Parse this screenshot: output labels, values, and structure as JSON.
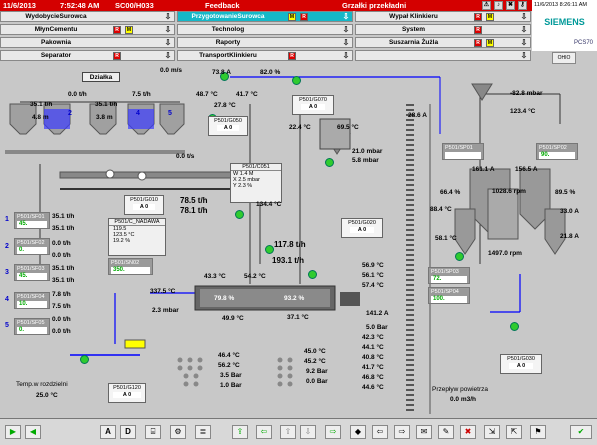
{
  "topbar": {
    "date": "11/6/2013",
    "time": "7:52:48 AM",
    "server": "SC00/H033",
    "center": "Feedback",
    "alarm": "Grzałki przekładni",
    "datetime_right": "11/6/2013 8:26:11 AM"
  },
  "nav": {
    "left": [
      "WydobycieSurowca",
      "MłynCementu",
      "Pakownia",
      "Separator"
    ],
    "middle": [
      "PrzygotowanieSurowca",
      "Technolog",
      "Raporty",
      "TransportKlinkieru"
    ],
    "right": [
      "Wypał Klinkieru",
      "System",
      "Suszarnia Żużla",
      ""
    ],
    "btn_m": "M",
    "btn_r": "R",
    "arrow": "⇩"
  },
  "logo": {
    "brand": "SIEMENS",
    "pcs": "PCS70",
    "oh": "OHIO"
  },
  "left": {
    "dzialka": "Działka",
    "top_rate": "0.0 m/s",
    "r1": "35.1 t/h",
    "r1b": "0.0 t/h",
    "r1c": "35.1 t/h",
    "r1d": "7.5 t/h",
    "m1": "4.8 m",
    "m2": "3.8 m",
    "silo_nums": [
      "1",
      "2",
      "3",
      "4",
      "5"
    ],
    "feed_rate": "0.0 t/s",
    "rows": [
      {
        "num": "1",
        "tag": "P501/SF01",
        "set": "45.",
        "a": "35.1 t/h",
        "b": "35.1 t/h"
      },
      {
        "num": "2",
        "tag": "P501/SF02",
        "set": "0.",
        "a": "0.0 t/h",
        "b": "0.0 t/h"
      },
      {
        "num": "3",
        "tag": "P501/SF03",
        "set": "45.",
        "a": "35.1 t/h",
        "b": "35.1 t/h"
      },
      {
        "num": "4",
        "tag": "P501/SF04",
        "set": "10.",
        "a": "7.8 t/h",
        "b": "7.5 t/h"
      },
      {
        "num": "5",
        "tag": "P501/SF05",
        "set": "0.",
        "a": "0.0 t/h",
        "b": "0.0 t/h"
      }
    ],
    "temp_label": "Temp.w rozdzielni",
    "temp_value": "25.0 °C",
    "g120": "P501/G120",
    "g120_btn": "A 0"
  },
  "center": {
    "amp1": "73.8 A",
    "pct1": "82.0 %",
    "v48": "48.7 °C",
    "v41": "41.7 °C",
    "v27": "27.8 °C",
    "g050": "P501/G050",
    "g070": "P501/G070",
    "g010": "P501/G010",
    "ab": "A 0",
    "c051": "P501/C051",
    "c051_w": "W",
    "c051_w_val": "1.4",
    "c051_w_unit": "M",
    "c051_x": "X",
    "c051_x_val": "2.5",
    "c051_x_unit": "mbar",
    "c051_y": "Y",
    "c051_y_val": "2.3",
    "c051_y_unit": "%",
    "nadawa": "P501/C_NADAWA",
    "nad_w": "119.5",
    "nad_x": "123.5 °C",
    "nad_y": "19.2 %",
    "feed1": "78.5 t/h",
    "feed2": "78.1 t/h",
    "set_tag": "P501/SN02",
    "set_val": "350.",
    "t43": "43.3 °C",
    "t54": "54.2 °C",
    "t134": "134.4 °C",
    "f117": "117.8 t/h",
    "f193": "193.1 t/h",
    "t337": "337.5 °C",
    "m23": "2.3 mbar",
    "mill_pct": "79.8 %",
    "mill_pct2": "93.2 %",
    "t49": "49.9 °C",
    "t37": "37.1 °C",
    "t46": "46.4 °C",
    "t56": "56.2 °C",
    "b35": "3.5 Bar",
    "b10": "1.0 Bar",
    "v45": "45.0 °C",
    "v452": "45.2 °C",
    "b92": "9.2 Bar",
    "b00": "0.0 Bar",
    "g020": "P501/G020",
    "t22": "22.4 °C",
    "t695": "69.5 °C",
    "m21": "21.0 mbar",
    "m58": "5.8 mbar",
    "t569": "56.9 °C",
    "t561": "56.1 °C",
    "t574": "57.4 °C",
    "a141": "141.2 A",
    "b50": "5.0 Bar",
    "t423": "42.3 °C",
    "t441": "44.1 °C",
    "t408": "40.8 °C",
    "t417": "41.7 °C",
    "t468": "46.8 °C",
    "t446": "44.6 °C"
  },
  "right": {
    "a286": "28.6 A",
    "mbar": "-82.8 mbar",
    "t1234": "123.4 °C",
    "sp1_tag": "P501/SP01",
    "sp1_val": "",
    "sp2_tag": "P501/SP02",
    "sp2_val": "90.",
    "a1611": "161.1 A",
    "a1565": "156.5 A",
    "p664": "66.4 %",
    "rpm1": "1028.6 rpm",
    "p895": "89.5 %",
    "t884": "88.4 °C",
    "a330": "33.0 A",
    "t581": "58.1 °C",
    "a218": "21.8 A",
    "rpm2": "1497.0 rpm",
    "sp3_tag": "P501/SP03",
    "sp3_val": "72.",
    "sp4_tag": "P501/SP04",
    "sp4_val": "100.",
    "g030": "P501/G030",
    "air_label": "Przepływ powietrza",
    "air_val": "0.0 m3/h"
  },
  "bottom": {
    "labels": [
      "▶",
      "◀",
      "A",
      "D",
      "⌸",
      "⚙",
      "≣",
      "⇪",
      "⇦",
      "⇧",
      "⇩",
      "⇨",
      "◆",
      "⇦",
      "⇨",
      "✉",
      "✎",
      "✖",
      "⇲",
      "⇱",
      "⚑",
      "✔"
    ]
  }
}
